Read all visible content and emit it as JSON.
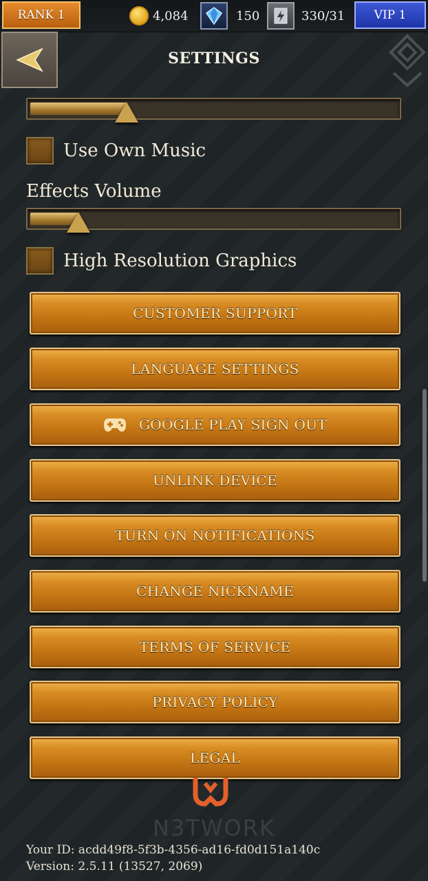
{
  "topbar": {
    "rank": "RANK 1",
    "coins": "4,084",
    "gems": "150",
    "energy": "330/31",
    "vip": "VIP 1"
  },
  "header": {
    "title": "SETTINGS"
  },
  "settings": {
    "music_volume": 0.26,
    "use_own_music_label": "Use Own Music",
    "effects_volume_label": "Effects Volume",
    "effects_volume": 0.13,
    "high_res_label": "High Resolution Graphics"
  },
  "menu": [
    "CUSTOMER SUPPORT",
    "LANGUAGE SETTINGS",
    "GOOGLE PLAY SIGN OUT",
    "UNLINK DEVICE",
    "TURN ON NOTIFICATIONS",
    "CHANGE NICKNAME",
    "TERMS OF SERVICE",
    "PRIVACY POLICY",
    "LEGAL"
  ],
  "brand": {
    "wordmark": "N3TWORK"
  },
  "footer": {
    "user_id": "Your ID: acdd49f8-5f3b-4356-ad16-fd0d151a140c",
    "version": "Version: 2.5.11 (13527, 2069)"
  },
  "colors": {
    "button": "#c57614",
    "rank": "#d9781f",
    "vip": "#2a41c0",
    "logo": "#e2612a"
  }
}
